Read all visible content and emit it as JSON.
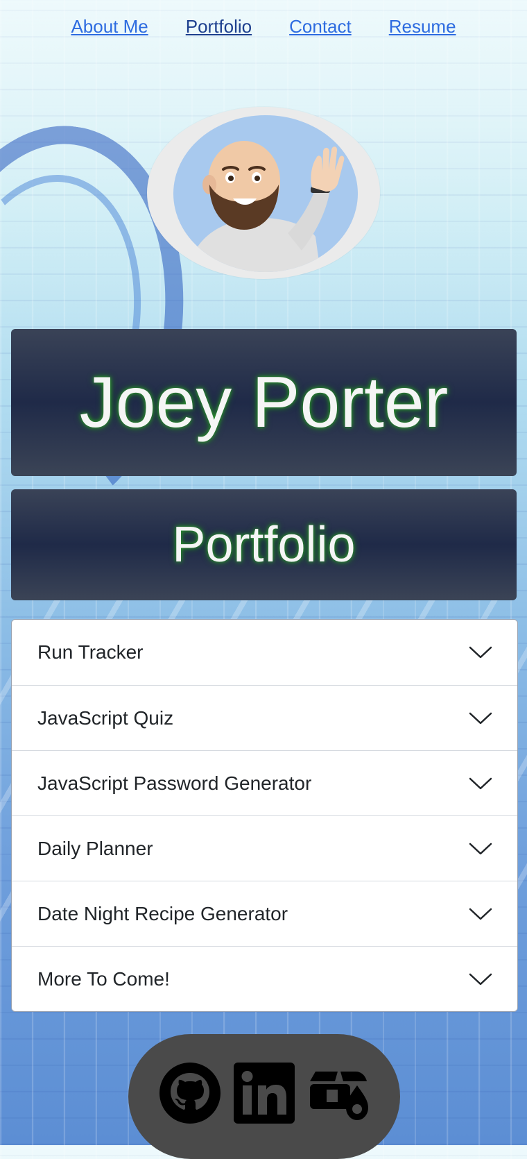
{
  "nav": {
    "items": [
      "About Me",
      "Portfolio",
      "Contact",
      "Resume"
    ]
  },
  "header": {
    "name": "Joey Porter",
    "section_title": "Portfolio"
  },
  "accordion": {
    "items": [
      "Run Tracker",
      "JavaScript Quiz",
      "JavaScript Password Generator",
      "Daily Planner",
      "Date Night Recipe Generator",
      "More To Come!"
    ]
  },
  "footer": {
    "icons": [
      "github-icon",
      "linkedin-icon",
      "truck-icon"
    ]
  },
  "colors": {
    "link": "#2d6be0",
    "banner": "#1f2a48",
    "glow": "#2e9c2e",
    "pill": "#4a4a4a"
  }
}
